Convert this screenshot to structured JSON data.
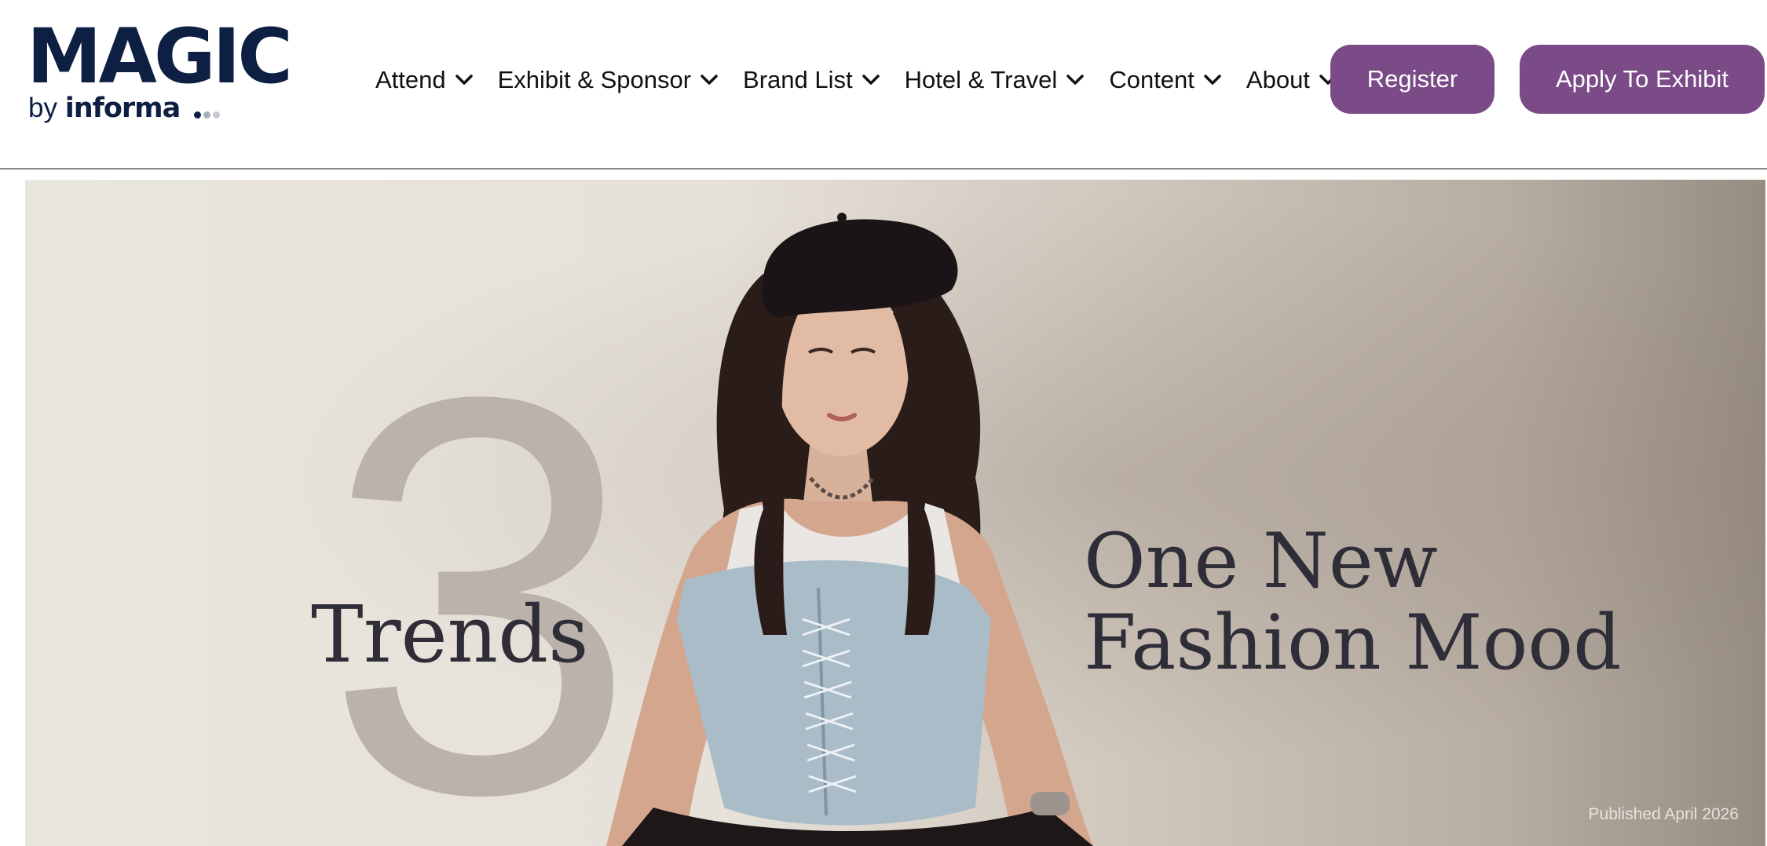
{
  "logo": {
    "title": "MAGIC",
    "by": "by",
    "brand": "informa",
    "dot_colors": [
      "#0e1f44",
      "#a8acb6",
      "#c6c9cf"
    ]
  },
  "nav": {
    "items": [
      {
        "label": "Attend"
      },
      {
        "label": "Exhibit & Sponsor"
      },
      {
        "label": "Brand List"
      },
      {
        "label": "Hotel & Travel"
      },
      {
        "label": "Content"
      },
      {
        "label": "About"
      }
    ],
    "dropdown_icon": "chevron-down-icon"
  },
  "buttons": {
    "register": "Register",
    "apply": "Apply To Exhibit"
  },
  "hero": {
    "big_number": "3",
    "trends": "Trends",
    "headline_line1": "One New",
    "headline_line2": "Fashion Mood",
    "published": "Published April 2026"
  },
  "colors": {
    "brand_navy": "#0e1f44",
    "button_purple": "#7a4b87",
    "headline_text": "#2f2d38"
  }
}
